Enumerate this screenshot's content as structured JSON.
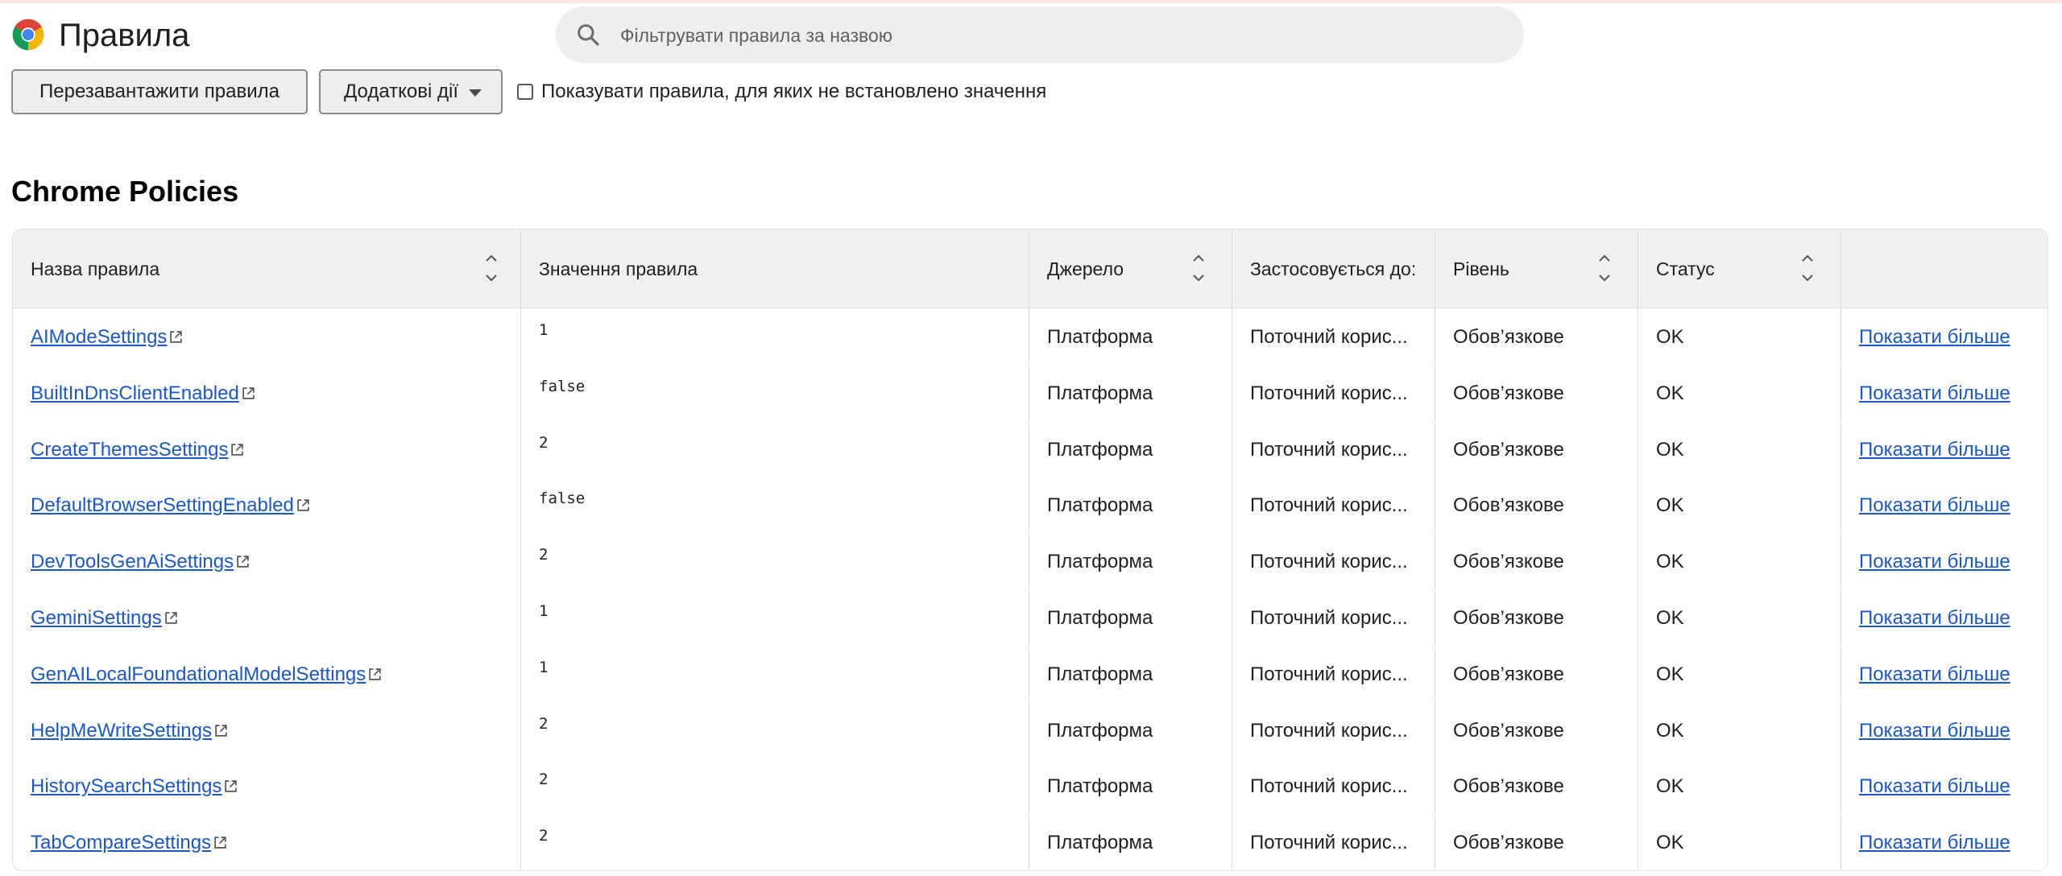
{
  "header": {
    "title": "Правила",
    "logo_icon": "chrome-logo-icon",
    "search_placeholder": "Фільтрувати правила за назвою",
    "search_value": ""
  },
  "toolbar": {
    "reload_label": "Перезавантажити правила",
    "more_actions_label": "Додаткові дії",
    "show_unset_label": "Показувати правила, для яких не встановлено значення",
    "show_unset_checked": false
  },
  "section": {
    "title": "Chrome Policies"
  },
  "table": {
    "columns": [
      {
        "label": "Назва правила",
        "sortable": true
      },
      {
        "label": "Значення правила",
        "sortable": false
      },
      {
        "label": "Джерело",
        "sortable": true
      },
      {
        "label": "Застосовується до:",
        "sortable": false
      },
      {
        "label": "Рівень",
        "sortable": true
      },
      {
        "label": "Статус",
        "sortable": true
      },
      {
        "label": "",
        "sortable": false
      }
    ],
    "rows": [
      {
        "name": "AIModeSettings",
        "value": "1",
        "source": "Платформа",
        "applies_to": "Поточний корис...",
        "level": "Обов’язкове",
        "status": "OK",
        "more": "Показати більше"
      },
      {
        "name": "BuiltInDnsClientEnabled",
        "value": "false",
        "source": "Платформа",
        "applies_to": "Поточний корис...",
        "level": "Обов’язкове",
        "status": "OK",
        "more": "Показати більше"
      },
      {
        "name": "CreateThemesSettings",
        "value": "2",
        "source": "Платформа",
        "applies_to": "Поточний корис...",
        "level": "Обов’язкове",
        "status": "OK",
        "more": "Показати більше"
      },
      {
        "name": "DefaultBrowserSettingEnabled",
        "value": "false",
        "source": "Платформа",
        "applies_to": "Поточний корис...",
        "level": "Обов’язкове",
        "status": "OK",
        "more": "Показати більше"
      },
      {
        "name": "DevToolsGenAiSettings",
        "value": "2",
        "source": "Платформа",
        "applies_to": "Поточний корис...",
        "level": "Обов’язкове",
        "status": "OK",
        "more": "Показати більше"
      },
      {
        "name": "GeminiSettings",
        "value": "1",
        "source": "Платформа",
        "applies_to": "Поточний корис...",
        "level": "Обов’язкове",
        "status": "OK",
        "more": "Показати більше"
      },
      {
        "name": "GenAILocalFoundationalModelSettings",
        "value": "1",
        "source": "Платформа",
        "applies_to": "Поточний корис...",
        "level": "Обов’язкове",
        "status": "OK",
        "more": "Показати більше"
      },
      {
        "name": "HelpMeWriteSettings",
        "value": "2",
        "source": "Платформа",
        "applies_to": "Поточний корис...",
        "level": "Обов’язкове",
        "status": "OK",
        "more": "Показати більше"
      },
      {
        "name": "HistorySearchSettings",
        "value": "2",
        "source": "Платформа",
        "applies_to": "Поточний корис...",
        "level": "Обов’язкове",
        "status": "OK",
        "more": "Показати більше"
      },
      {
        "name": "TabCompareSettings",
        "value": "2",
        "source": "Платформа",
        "applies_to": "Поточний корис...",
        "level": "Обов’язкове",
        "status": "OK",
        "more": "Показати більше"
      }
    ]
  },
  "colors": {
    "link": "#1a57c8",
    "header_bg": "#f0f0f0",
    "search_bg": "#eeeeee"
  }
}
